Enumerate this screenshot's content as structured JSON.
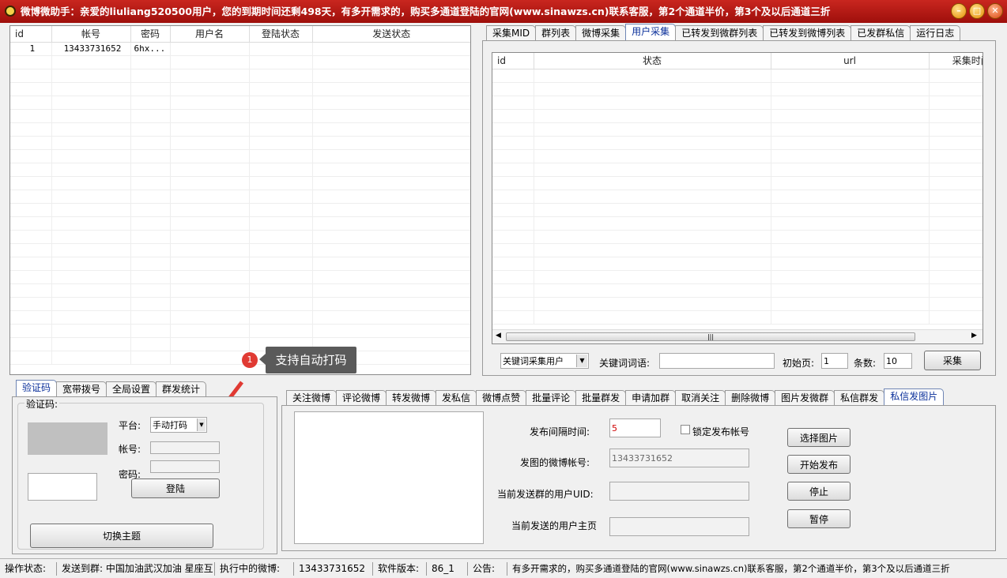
{
  "window": {
    "title": "微博微助手：亲爱的liuliang520500用户，您的到期时间还剩498天，有多开需求的，购买多通道登陆的官网(www.sinawzs.cn)联系客服，第2个通道半价，第3个及以后通道三折",
    "minimize": "–",
    "maximize": "□",
    "close": "✕"
  },
  "accounts": {
    "columns": [
      "id",
      "帐号",
      "密码",
      "用户名",
      "登陆状态",
      "发送状态"
    ],
    "rows": [
      {
        "id": "1",
        "account": "13433731652",
        "password": "6hx...",
        "username": "",
        "login_status": "",
        "send_status": ""
      }
    ]
  },
  "right_tabs": [
    "采集MID",
    "群列表",
    "微博采集",
    "用户采集",
    "已转发到微群列表",
    "已转发到微博列表",
    "已发群私信",
    "运行日志"
  ],
  "right_tabs_active": 3,
  "collect_table": {
    "columns": [
      "id",
      "状态",
      "url",
      "采集时间"
    ]
  },
  "collect_form": {
    "mode": "关键词采集用户",
    "keyword_label": "关键词词语:",
    "keyword_value": "",
    "start_page_label": "初始页:",
    "start_page_value": "1",
    "count_label": "条数:",
    "count_value": "10",
    "collect_button": "采集"
  },
  "tooltip": {
    "badge": "1",
    "text": "支持自动打码"
  },
  "left_tabs": [
    "验证码",
    "宽带拨号",
    "全局设置",
    "群发统计"
  ],
  "left_tabs_active": 0,
  "captcha": {
    "group_label": "验证码:",
    "platform_label": "平台:",
    "platform_value": "手动打码",
    "account_label": "帐号:",
    "password_label": "密码:",
    "login_button": "登陆",
    "theme_button": "切换主题"
  },
  "bottom_tabs": [
    "关注微博",
    "评论微博",
    "转发微博",
    "发私信",
    "微博点赞",
    "批量评论",
    "批量群发",
    "申请加群",
    "取消关注",
    "删除微博",
    "图片发微群",
    "私信群发",
    "私信发图片"
  ],
  "bottom_tabs_active": 12,
  "publish": {
    "interval_label": "发布间隔时间:",
    "interval_value": "5",
    "lock_label": "锁定发布帐号",
    "account_label": "发图的微博帐号:",
    "account_value": "13433731652",
    "uid_label": "当前发送群的用户UID:",
    "uid_value": "",
    "homepage_label": "当前发送的用户主页",
    "homepage_value": "",
    "select_image_button": "选择图片",
    "start_button": "开始发布",
    "stop_button": "停止",
    "pause_button": "暂停"
  },
  "statusbar": {
    "op_label": "操作状态:",
    "send_to": "发送到群: 中国加油武汉加油 星座互",
    "running_label": "执行中的微博:",
    "running_value": "13433731652",
    "version_label": "软件版本:",
    "version_value": "86_1",
    "notice_label": "公告:",
    "notice_value": "有多开需求的，购买多通道登陆的官网(www.sinawzs.cn)联系客服，第2个通道半价，第3个及以后通道三折"
  },
  "colors": {
    "titlebar": "#b81c15",
    "active_tab_text": "#0a2f9a",
    "tooltip_bg": "#5a5a5a",
    "badge": "#e03a33",
    "arrow": "#e03a33"
  }
}
